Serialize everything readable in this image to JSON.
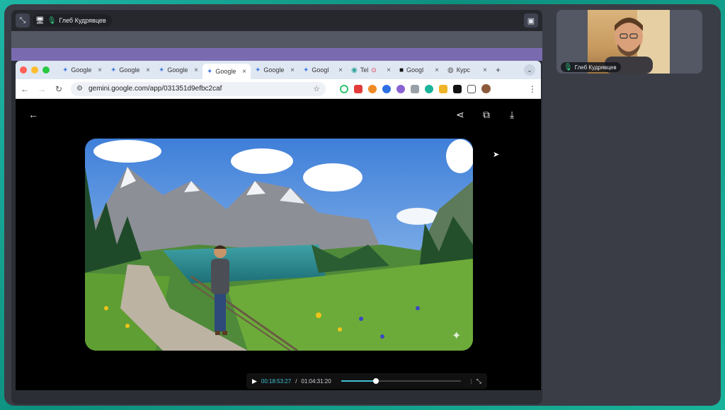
{
  "meeting": {
    "presenter_name": "Глеб Кудрявцев",
    "participant_name": "Глеб Кудрявцев"
  },
  "browser": {
    "tabs": [
      {
        "label": "Google",
        "icon": "gemini-icon"
      },
      {
        "label": "Google",
        "icon": "gemini-icon"
      },
      {
        "label": "Google",
        "icon": "gemini-icon"
      },
      {
        "label": "Google",
        "icon": "gemini-icon",
        "active": true
      },
      {
        "label": "Google",
        "icon": "gemini-icon"
      },
      {
        "label": "Googl",
        "icon": "gemini-icon"
      },
      {
        "label": "Tel",
        "icon": "telegram-icon"
      },
      {
        "label": "Googl",
        "icon": "square-icon"
      },
      {
        "label": "Курс",
        "icon": "globe-icon"
      }
    ],
    "url": "gemini.google.com/app/031351d9efbc2caf"
  },
  "video": {
    "current_time": "00:18:53:27",
    "separator": "/",
    "total_time": "01:04:31:20",
    "progress": 0.29
  },
  "colors": {
    "accent": "#3fc3d6",
    "frame_border": "#19b39b",
    "purple_band": "#7a6bb0"
  }
}
